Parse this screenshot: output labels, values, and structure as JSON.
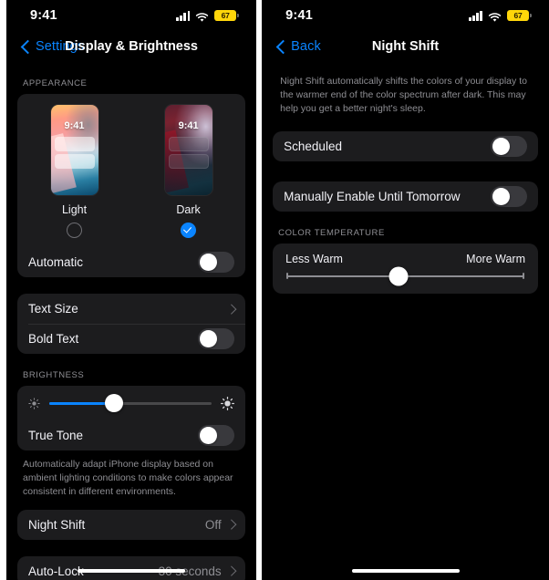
{
  "status_bar": {
    "time": "9:41",
    "cellular_icon": "cellular-bars-icon",
    "wifi_icon": "wifi-icon",
    "battery_percent": "67",
    "battery_color": "#ffd60a"
  },
  "accent_color": "#0a84ff",
  "left_panel": {
    "nav": {
      "back_label": "Settings",
      "title": "Display & Brightness"
    },
    "appearance": {
      "header": "APPEARANCE",
      "modes": [
        {
          "label": "Light",
          "preview_time": "9:41",
          "selected": false
        },
        {
          "label": "Dark",
          "preview_time": "9:41",
          "selected": true
        }
      ],
      "automatic": {
        "label": "Automatic",
        "state": "off"
      }
    },
    "text_group": {
      "text_size": {
        "label": "Text Size",
        "value": ""
      },
      "bold_text": {
        "label": "Bold Text",
        "state": "off"
      }
    },
    "brightness": {
      "header": "BRIGHTNESS",
      "slider_percent": 40,
      "low_icon": "sun-low-icon",
      "high_icon": "sun-high-icon",
      "true_tone": {
        "label": "True Tone",
        "state": "off"
      },
      "footnote": "Automatically adapt iPhone display based on ambient lighting conditions to make colors appear consistent in different environments."
    },
    "night_shift_row": {
      "label": "Night Shift",
      "value": "Off"
    },
    "auto_lock_row": {
      "label": "Auto-Lock",
      "value": "30 seconds"
    }
  },
  "right_panel": {
    "nav": {
      "back_label": "Back",
      "title": "Night Shift"
    },
    "intro": "Night Shift automatically shifts the colors of your display to the warmer end of the color spectrum after dark. This may help you get a better night's sleep.",
    "scheduled": {
      "label": "Scheduled",
      "state": "off"
    },
    "manual": {
      "label": "Manually Enable Until Tomorrow",
      "state": "off"
    },
    "color_temperature": {
      "header": "COLOR TEMPERATURE",
      "less_warm_label": "Less Warm",
      "more_warm_label": "More Warm",
      "slider_percent": 47
    }
  }
}
